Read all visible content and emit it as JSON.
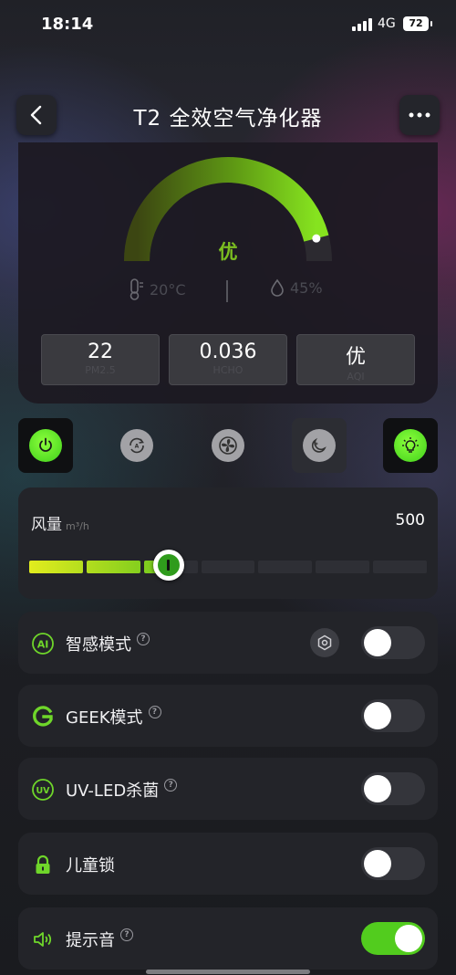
{
  "status_bar": {
    "time": "18:14",
    "network": "4G",
    "battery": "72"
  },
  "header": {
    "title": "T2 全效空气净化器",
    "back_icon": "chevron-left-icon",
    "more_icon": "more-dots-icon"
  },
  "gauge": {
    "label": "优",
    "level": 0.92,
    "start_color": "#4a5a10",
    "end_color": "#7ddc1f"
  },
  "environment": {
    "temperature": "20°C",
    "humidity": "45%"
  },
  "metrics": [
    {
      "value": "22",
      "label": "PM2.5"
    },
    {
      "value": "0.036",
      "label": "HCHO"
    },
    {
      "value": "优",
      "label": "AQI"
    }
  ],
  "modes": [
    {
      "name": "power",
      "icon": "power-icon",
      "active": true
    },
    {
      "name": "auto",
      "icon": "auto-mode-icon",
      "active": false
    },
    {
      "name": "fan",
      "icon": "fan-icon",
      "active": false
    },
    {
      "name": "sleep",
      "icon": "moon-icon",
      "active": false
    },
    {
      "name": "light",
      "icon": "light-bulb-icon",
      "active": true
    }
  ],
  "wind": {
    "label": "风量",
    "unit": "m³/h",
    "value": "500",
    "level": 0.35
  },
  "settings": [
    {
      "key": "smart",
      "label": "智感模式",
      "icon": "ai-icon",
      "help": true,
      "has_settings": true,
      "on": false
    },
    {
      "key": "geek",
      "label": "GEEK模式",
      "icon": "geek-g-icon",
      "help": true,
      "has_settings": false,
      "on": false
    },
    {
      "key": "uv",
      "label": "UV-LED杀菌",
      "icon": "uv-icon",
      "help": true,
      "has_settings": false,
      "on": false
    },
    {
      "key": "child",
      "label": "儿童锁",
      "icon": "lock-icon",
      "help": false,
      "has_settings": false,
      "on": false
    },
    {
      "key": "sound",
      "label": "提示音",
      "icon": "speaker-icon",
      "help": true,
      "has_settings": false,
      "on": true
    }
  ],
  "help_glyph": "?",
  "colors": {
    "accent": "#52cc1e",
    "card": "#232429",
    "muted": "#4a4a52"
  }
}
